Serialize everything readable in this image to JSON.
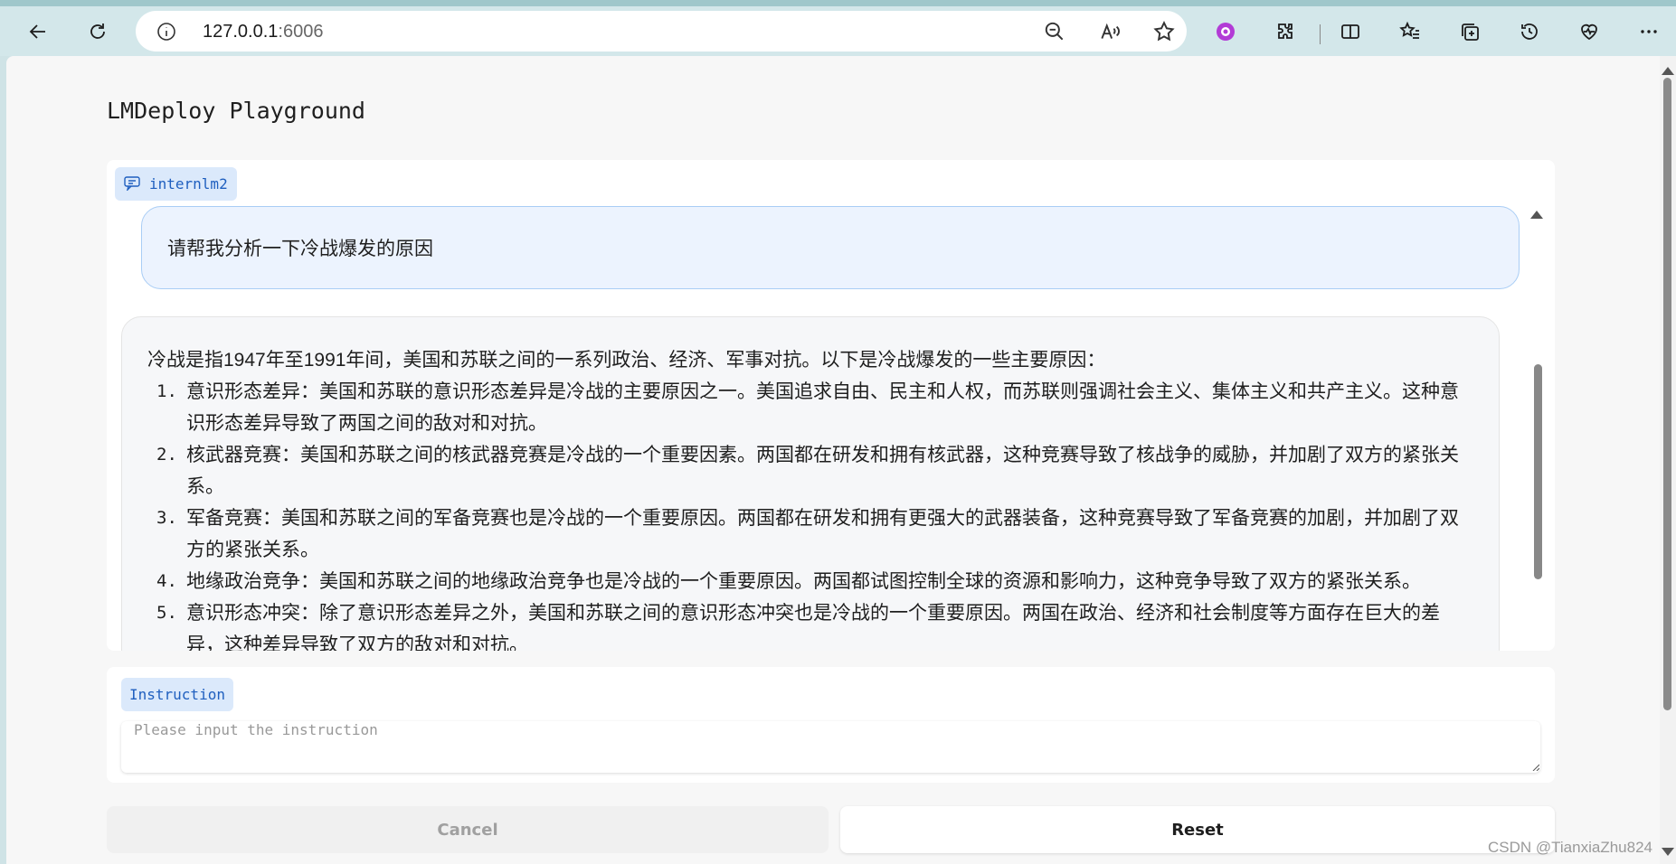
{
  "browser": {
    "url_host": "127.0.0.1",
    "url_port": ":6006"
  },
  "page": {
    "title": "LMDeploy Playground"
  },
  "chat": {
    "model_label": "internlm2",
    "user_message": "请帮我分析一下冷战爆发的原因",
    "bot_intro": "冷战是指1947年至1991年间，美国和苏联之间的一系列政治、经济、军事对抗。以下是冷战爆发的一些主要原因：",
    "bot_items": [
      {
        "num": "1.",
        "text": "意识形态差异：美国和苏联的意识形态差异是冷战的主要原因之一。美国追求自由、民主和人权，而苏联则强调社会主义、集体主义和共产主义。这种意识形态差异导致了两国之间的敌对和对抗。"
      },
      {
        "num": "2.",
        "text": "核武器竞赛：美国和苏联之间的核武器竞赛是冷战的一个重要因素。两国都在研发和拥有核武器，这种竞赛导致了核战争的威胁，并加剧了双方的紧张关系。"
      },
      {
        "num": "3.",
        "text": "军备竞赛：美国和苏联之间的军备竞赛也是冷战的一个重要原因。两国都在研发和拥有更强大的武器装备，这种竞赛导致了军备竞赛的加剧，并加剧了双方的紧张关系。"
      },
      {
        "num": "4.",
        "text": "地缘政治竞争：美国和苏联之间的地缘政治竞争也是冷战的一个重要原因。两国都试图控制全球的资源和影响力，这种竞争导致了双方的紧张关系。"
      },
      {
        "num": "5.",
        "text": "意识形态冲突：除了意识形态差异之外，美国和苏联之间的意识形态冲突也是冷战的一个重要原因。两国在政治、经济和社会制度等方面存在巨大的差异，这种差异导致了双方的敌对和对抗。"
      }
    ]
  },
  "instruction": {
    "label": "Instruction",
    "placeholder": "Please input the instruction"
  },
  "buttons": {
    "cancel": "Cancel",
    "reset": "Reset"
  },
  "watermark": "CSDN @TianxiaZhu824",
  "colors": {
    "accent": "#1f5fbf",
    "badge_bg": "#dbe9fb",
    "user_bubble_bg": "#ecf3fe",
    "user_bubble_border": "#a9cdf5",
    "browser_bg": "#d3e7ea"
  },
  "icons": {
    "back": "arrow-left-icon",
    "refresh": "refresh-icon",
    "info": "info-icon",
    "zoom": "zoom-out-icon",
    "read_aloud": "read-aloud-icon",
    "favorite": "star-icon"
  }
}
